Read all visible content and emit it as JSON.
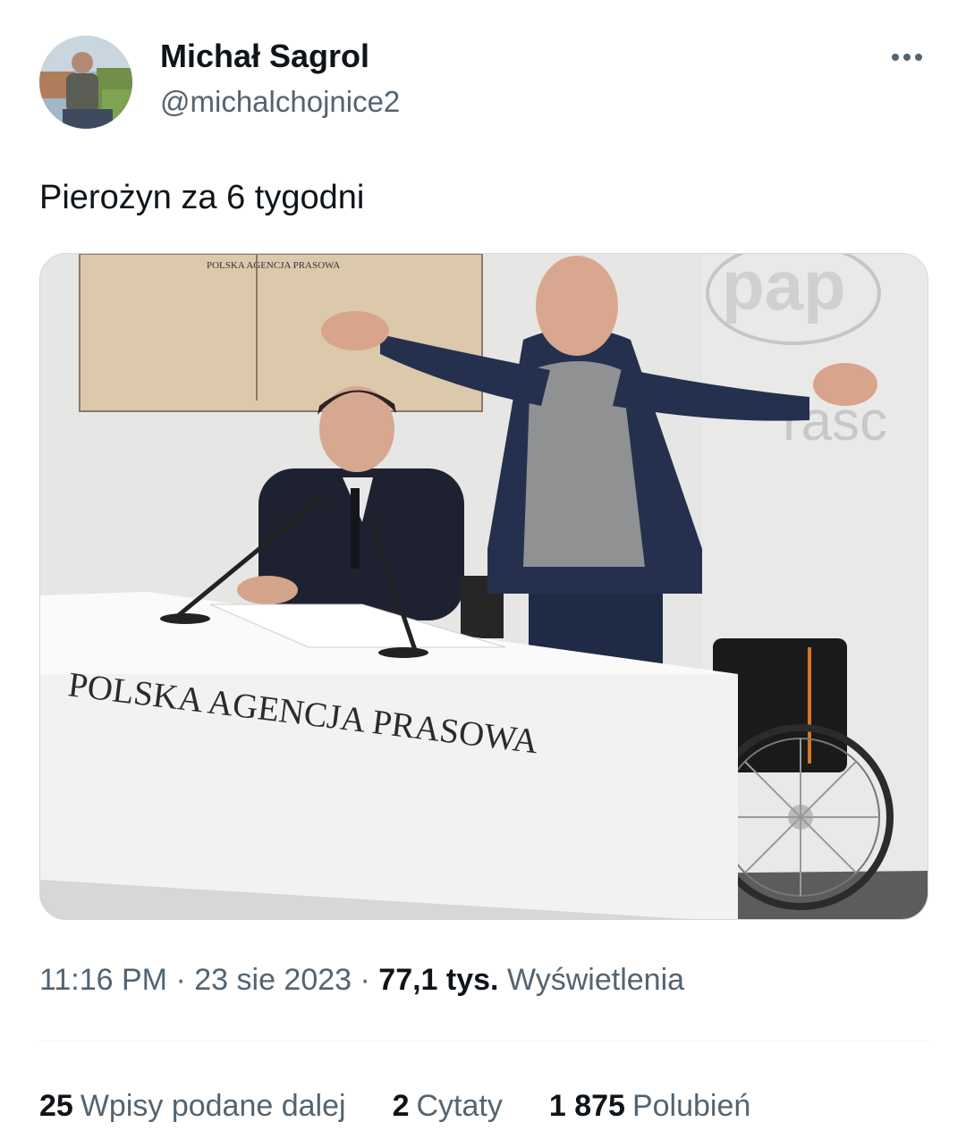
{
  "author": {
    "name": "Michał Sagrol",
    "handle": "@michalchojnice2"
  },
  "tweet": {
    "text": "Pierożyn za 6 tygodni"
  },
  "media": {
    "board_label": "POLSKA AGENCJA PRASOWA",
    "desk_label": "POLSKA AGENCJA PRASOWA",
    "logo_text": "pap",
    "wall_text": "rasc"
  },
  "meta": {
    "time": "11:16 PM",
    "separator": "·",
    "date": "23 sie 2023",
    "views_count": "77,1 tys.",
    "views_label": "Wyświetlenia"
  },
  "stats": {
    "reposts_count": "25",
    "reposts_label": "Wpisy podane dalej",
    "quotes_count": "2",
    "quotes_label": "Cytaty",
    "likes_count": "1 875",
    "likes_label": "Polubień"
  }
}
